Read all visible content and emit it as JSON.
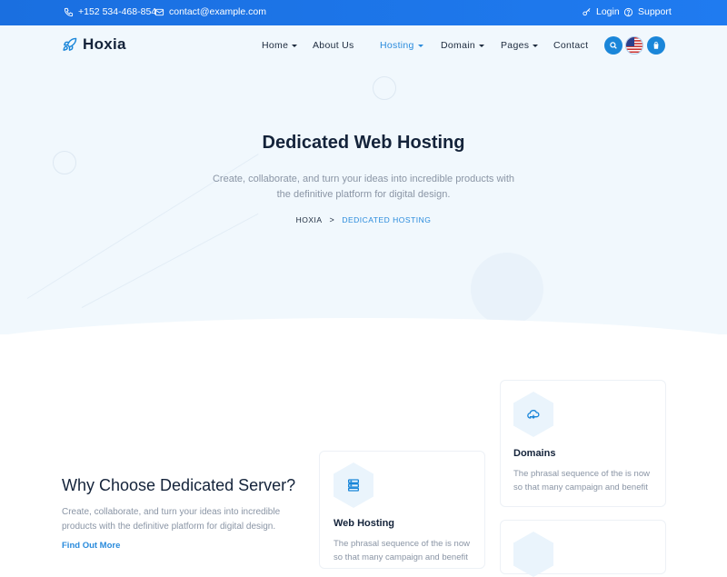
{
  "topbar": {
    "phone": "+152 534-468-854",
    "email": "contact@example.com",
    "login": "Login",
    "support": "Support"
  },
  "brand": {
    "name": "Hoxia"
  },
  "nav": {
    "home": "Home",
    "about": "About Us",
    "hosting": "Hosting",
    "domain": "Domain",
    "pages": "Pages",
    "contact": "Contact"
  },
  "hero": {
    "title": "Dedicated Web Hosting",
    "subtitle": "Create, collaborate, and turn your ideas into incredible products with the definitive platform for digital design.",
    "breadcrumb_home": "HOXIA",
    "breadcrumb_separator": ">",
    "breadcrumb_current": "DEDICATED HOSTING"
  },
  "why": {
    "title": "Why Choose Dedicated Server?",
    "text": "Create, collaborate, and turn your ideas into incredible products with the definitive platform for digital design.",
    "link": "Find Out More"
  },
  "cards": {
    "domains": {
      "title": "Domains",
      "text": "The phrasal sequence of the is now so that many campaign and benefit"
    },
    "web_hosting": {
      "title": "Web Hosting",
      "text": "The phrasal sequence of the is now so that many campaign and benefit"
    }
  },
  "colors": {
    "accent": "#1a86d9",
    "topbar": "#1f7bf0",
    "heading": "#14233a",
    "muted": "#8a95a5",
    "hero_bg": "#f1f8fd"
  },
  "icons": {
    "phone": "phone-icon",
    "email": "envelope-icon",
    "login": "key-icon",
    "support": "help-circle-icon",
    "logo": "rocket-icon",
    "search": "search-icon",
    "language": "us-flag-icon",
    "cart": "shopping-bag-icon",
    "domains": "cloud-icon",
    "web_hosting": "server-icon"
  }
}
